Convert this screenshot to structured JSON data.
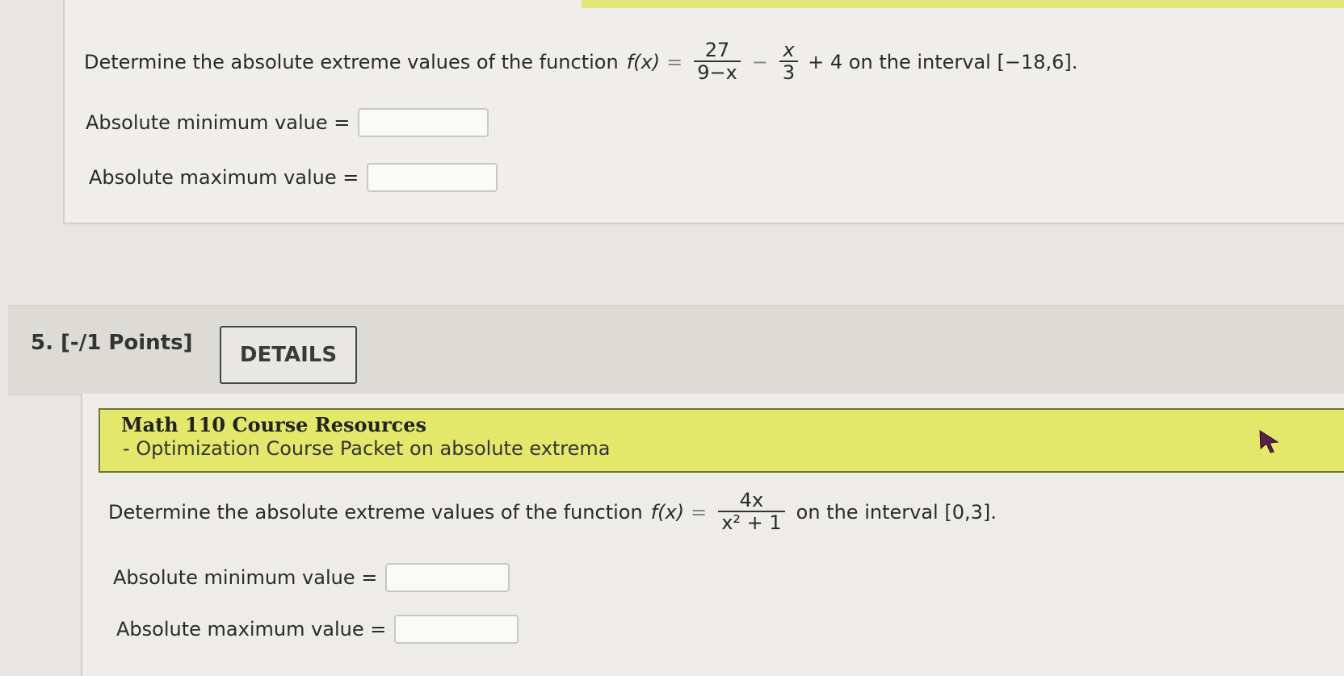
{
  "q4": {
    "problem": {
      "prefix": "Determine the absolute extreme values of the function",
      "fname": "f(x)",
      "eq": "=",
      "frac1_num": "27",
      "frac1_den": "9−x",
      "minus": "−",
      "frac2_num": "x",
      "frac2_den": "3",
      "tail": "+ 4 on the interval [−18,6]."
    },
    "min_label": "Absolute minimum value =",
    "max_label": "Absolute maximum value =",
    "min_value": "",
    "max_value": ""
  },
  "q5": {
    "number_points": "5.  [-/1 Points]",
    "details_label": "DETAILS",
    "resources_title": "Math 110 Course Resources",
    "resources_link": "- Optimization Course Packet on absolute extrema",
    "problem": {
      "prefix": "Determine the absolute extreme values of the function",
      "fname": "f(x)",
      "eq": "=",
      "frac_num": "4x",
      "frac_den": "x² + 1",
      "tail": "on the interval [0,3]."
    },
    "min_label": "Absolute minimum value =",
    "max_label": "Absolute maximum value =",
    "min_value": "",
    "max_value": ""
  },
  "colors": {
    "accent_yellow": "#e3e86a",
    "background": "#e6e5e1"
  },
  "icons": {
    "cursor": "mouse-pointer-icon"
  }
}
